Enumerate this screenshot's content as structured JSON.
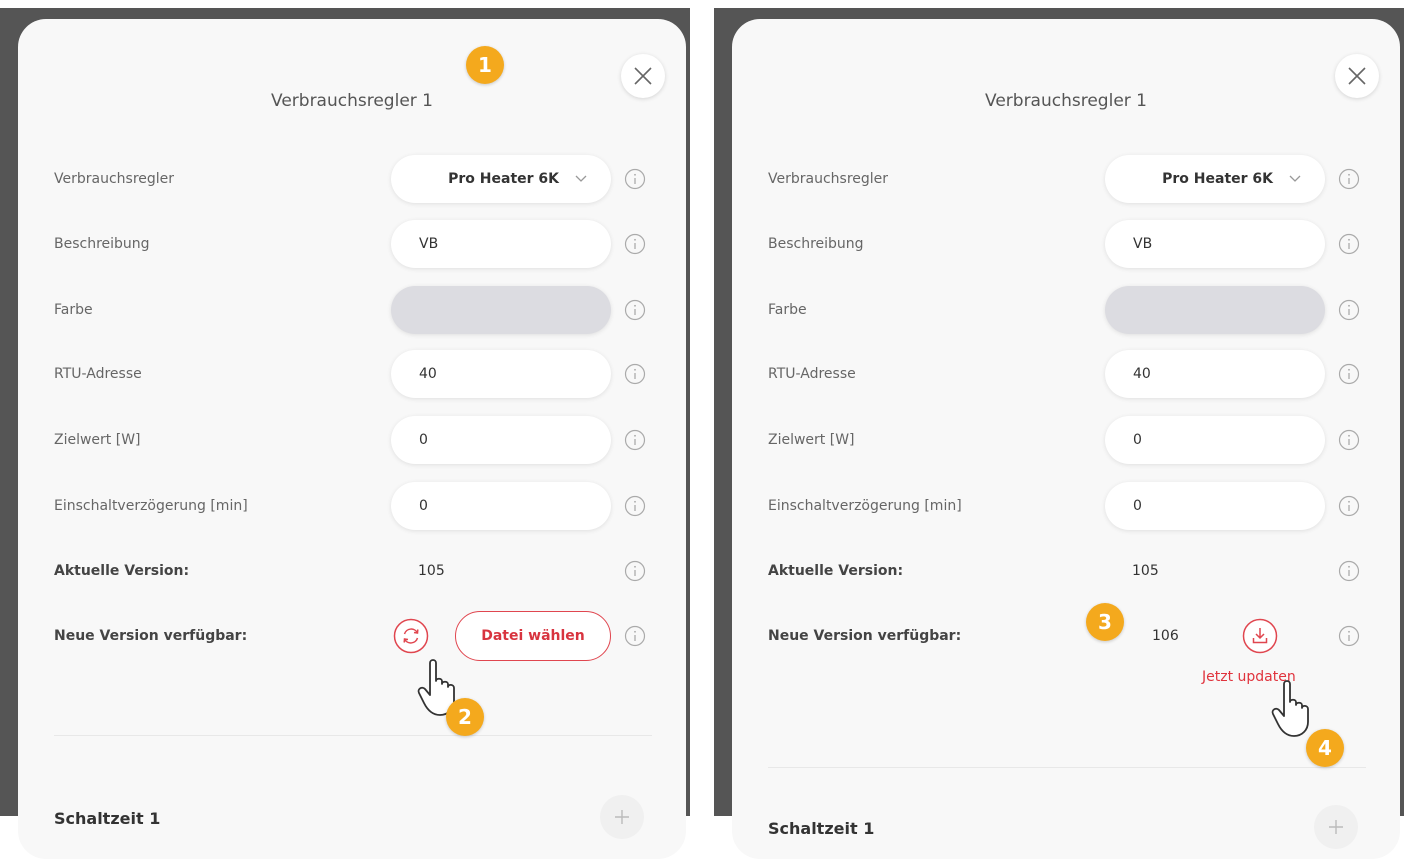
{
  "panels": [
    {
      "title": "Verbrauchsregler 1",
      "rows": {
        "regler": {
          "label": "Verbrauchsregler",
          "value": "Pro Heater 6K"
        },
        "beschreibung": {
          "label": "Beschreibung",
          "value": "VB"
        },
        "farbe": {
          "label": "Farbe"
        },
        "rtu": {
          "label": "RTU-Adresse",
          "value": "40"
        },
        "zielwert": {
          "label": "Zielwert [W]",
          "value": "0"
        },
        "verzoegerung": {
          "label": "Einschaltverzögerung [min]",
          "value": "0"
        },
        "aktuelle": {
          "label": "Aktuelle Version:",
          "value": "105"
        },
        "neue": {
          "label": "Neue Version verfügbar:",
          "file_button": "Datei wählen"
        }
      },
      "section_title": "Schaltzeit 1",
      "badges": [
        "1",
        "2"
      ]
    },
    {
      "title": "Verbrauchsregler 1",
      "rows": {
        "regler": {
          "label": "Verbrauchsregler",
          "value": "Pro Heater 6K"
        },
        "beschreibung": {
          "label": "Beschreibung",
          "value": "VB"
        },
        "farbe": {
          "label": "Farbe"
        },
        "rtu": {
          "label": "RTU-Adresse",
          "value": "40"
        },
        "zielwert": {
          "label": "Zielwert [W]",
          "value": "0"
        },
        "verzoegerung": {
          "label": "Einschaltverzögerung [min]",
          "value": "0"
        },
        "aktuelle": {
          "label": "Aktuelle Version:",
          "value": "105"
        },
        "neue": {
          "label": "Neue Version verfügbar:",
          "value": "106",
          "update_link": "Jetzt updaten"
        }
      },
      "section_title": "Schaltzeit 1",
      "badges": [
        "3",
        "4"
      ]
    }
  ],
  "colors": {
    "accent": "#e0464f",
    "badge": "#f4a91d",
    "color_swatch": "#dcdce1"
  },
  "icons": {
    "close": "close-icon",
    "info": "info-icon",
    "chevron": "chevron-down-icon",
    "refresh": "refresh-icon",
    "download": "download-icon",
    "add": "plus-icon",
    "pointer": "hand-pointer-icon"
  }
}
